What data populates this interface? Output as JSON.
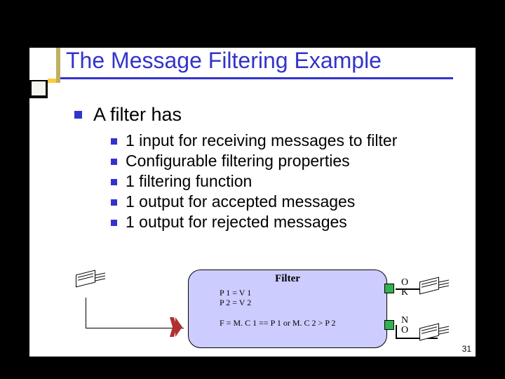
{
  "title": "The Message Filtering Example",
  "lvl1": "A filter has",
  "bullets": [
    "1 input for receiving messages to filter",
    "Configurable filtering properties",
    "1 filtering function",
    "1 output for accepted messages",
    "1 output for rejected messages"
  ],
  "diagram": {
    "filter_title": "Filter",
    "prop1": "P 1 = V 1",
    "prop2": "P 2 = V 2",
    "func": "F = M. C 1 == P 1 or M. C 2 > P 2",
    "ok": "O K",
    "no": "N O"
  },
  "pagenum": "31"
}
